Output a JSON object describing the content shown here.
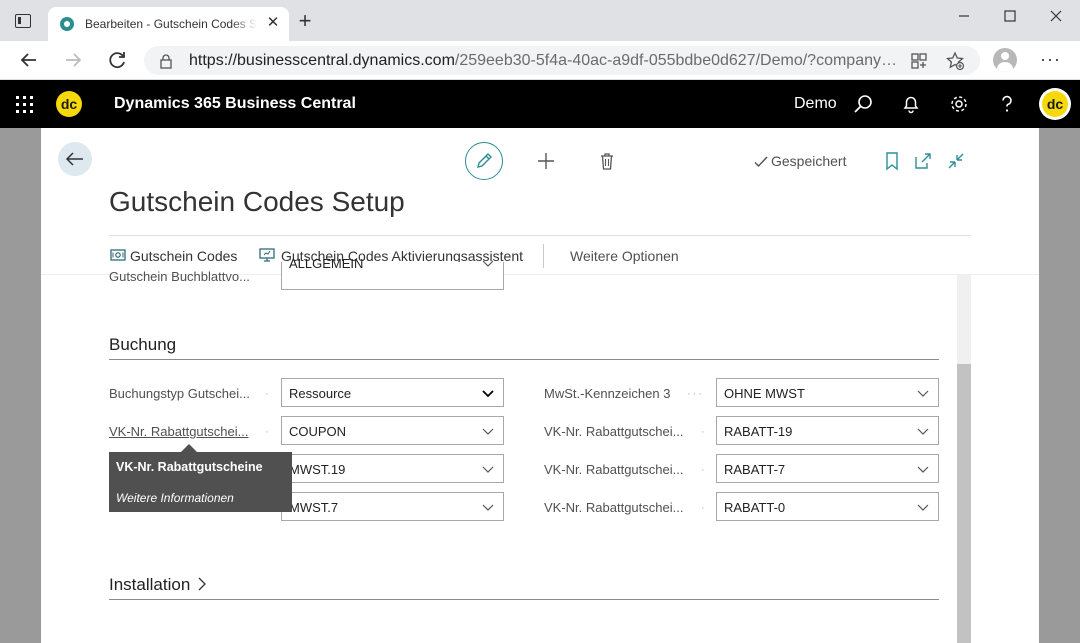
{
  "browser": {
    "tab_title": "Bearbeiten - Gutschein Codes Setup",
    "url_host": "https://businesscentral.dynamics.com",
    "url_path": "/259eeb30-5f4a-40ac-a9df-055bdbe0d627/Demo/?company=..."
  },
  "appbar": {
    "logo_text": "dc",
    "title": "Dynamics 365 Business Central",
    "company": "Demo"
  },
  "page": {
    "title": "Gutschein Codes Setup",
    "status": "Gespeichert",
    "actions": {
      "codes": "Gutschein Codes",
      "wizard": "Gutschein Codes Aktivierungsassistent",
      "more": "Weitere Optionen"
    },
    "cut_row": {
      "label": "Gutschein Buchblattvo...",
      "value": "ALLGEMEIN"
    },
    "section_buchung": "Buchung",
    "left_fields": [
      {
        "label": "Buchungstyp Gutschei...",
        "value": "Ressource"
      },
      {
        "label": "VK-Nr. Rabattgutschei...",
        "value": "COUPON"
      },
      {
        "label": "",
        "value": "MWST.19"
      },
      {
        "label": "",
        "value": "MWST.7"
      }
    ],
    "right_fields": [
      {
        "label": "MwSt.-Kennzeichen 3",
        "value": "OHNE MWST"
      },
      {
        "label": "VK-Nr. Rabattgutschei...",
        "value": "RABATT-19"
      },
      {
        "label": "VK-Nr. Rabattgutschei...",
        "value": "RABATT-7"
      },
      {
        "label": "VK-Nr. Rabattgutschei...",
        "value": "RABATT-0"
      }
    ],
    "tooltip": {
      "title": "VK-Nr. Rabattgutscheine",
      "more": "Weitere Informationen"
    },
    "section_installation": "Installation",
    "select_options": [
      "Ressource"
    ]
  }
}
